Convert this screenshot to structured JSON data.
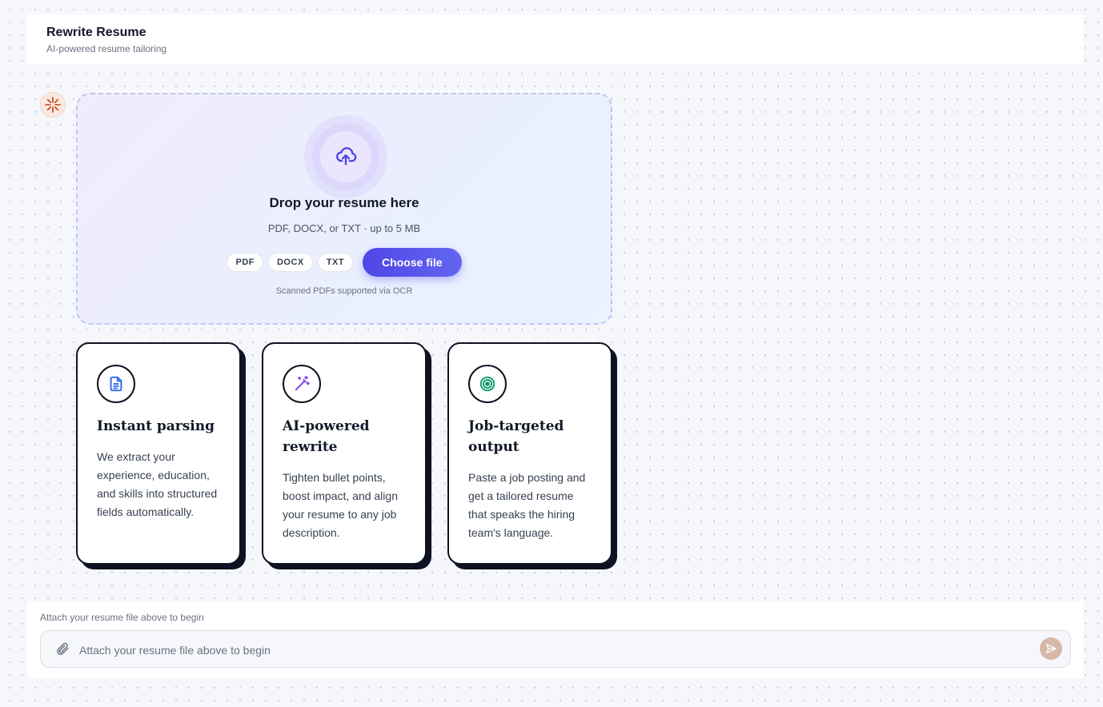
{
  "header": {
    "title": "Rewrite Resume",
    "subtitle": "AI-powered resume tailoring"
  },
  "assistant_avatar_icon": "sparkle-burst-icon",
  "upload": {
    "icon": "cloud-upload-icon",
    "title": "Drop your resume here",
    "subtitle": "PDF, DOCX, or TXT · up to 5 MB",
    "formats": [
      "PDF",
      "DOCX",
      "TXT"
    ],
    "button_label": "Choose file",
    "note": "Scanned PDFs supported via OCR",
    "accent_color": "#4f46e5"
  },
  "features": [
    {
      "icon": "document-icon",
      "icon_color": "#2563eb",
      "title": "Instant parsing",
      "text": "We extract your experience, education, and skills into structured fields automatically."
    },
    {
      "icon": "magic-wand-icon",
      "icon_color": "#7c3aed",
      "title": "AI-powered rewrite",
      "text": "Tighten bullet points, boost impact, and align your resume to any job description."
    },
    {
      "icon": "target-icon",
      "icon_color": "#059669",
      "title": "Job-targeted output",
      "text": "Paste a job posting and get a tailored resume that speaks the hiring team's language."
    }
  ],
  "composer": {
    "hint": "Attach your resume file above to begin",
    "placeholder": "Attach your resume file above to begin",
    "value": "",
    "attach_icon": "paperclip-icon",
    "send_icon": "send-icon",
    "send_color": "#d5b8a5"
  }
}
